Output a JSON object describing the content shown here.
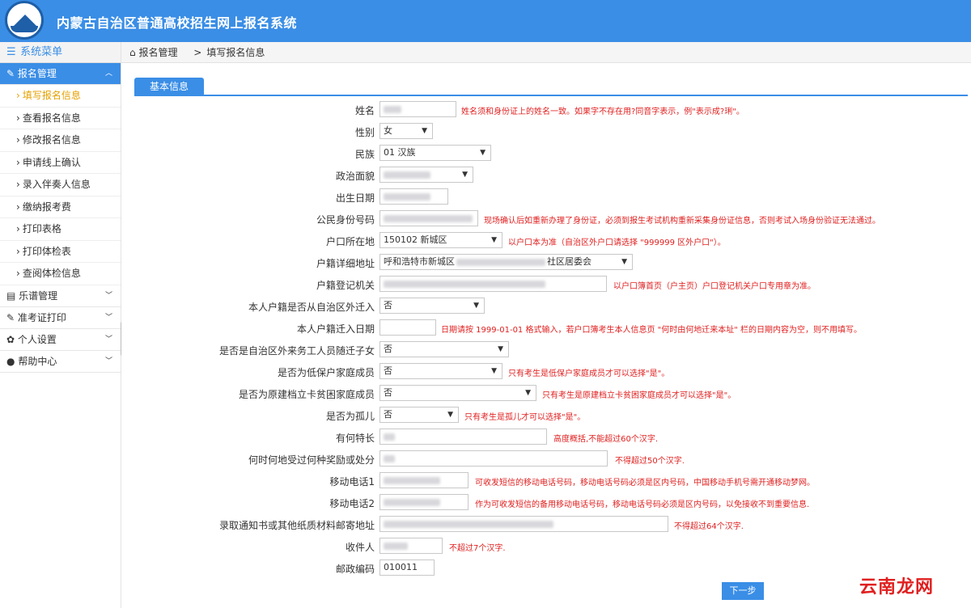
{
  "app": {
    "title": "内蒙古自治区普通高校招生网上报名系统"
  },
  "sidebar": {
    "header": "系统菜单",
    "groups": [
      {
        "label": "报名管理",
        "active": true,
        "items": [
          {
            "label": "填写报名信息",
            "current": true
          },
          {
            "label": "查看报名信息"
          },
          {
            "label": "修改报名信息"
          },
          {
            "label": "申请线上确认"
          },
          {
            "label": "录入伴奏人信息"
          },
          {
            "label": "缴纳报考费"
          },
          {
            "label": "打印表格"
          },
          {
            "label": "打印体检表"
          },
          {
            "label": "查阅体检信息"
          }
        ]
      },
      {
        "label": "乐谱管理"
      },
      {
        "label": "准考证打印"
      },
      {
        "label": "个人设置"
      },
      {
        "label": "帮助中心"
      }
    ]
  },
  "breadcrumb": {
    "home": "报名管理",
    "current": "填写报名信息"
  },
  "tab": "基本信息",
  "form": {
    "fields": [
      {
        "label": "姓名",
        "value": "",
        "hint": "姓名须和身份证上的姓名一致。如果字不存在用?同音字表示，例\"表示成?琍\"。"
      },
      {
        "label": "性别",
        "value": "女"
      },
      {
        "label": "民族",
        "value": "01 汉族"
      },
      {
        "label": "政治面貌",
        "value": ""
      },
      {
        "label": "出生日期",
        "value": ""
      },
      {
        "label": "公民身份号码",
        "value": "",
        "hint": "现场确认后如重新办理了身份证，必须到报生考试机构重新采集身份证信息，否则考试入场身份验证无法通过。"
      },
      {
        "label": "户口所在地",
        "value": "150102 新城区",
        "hint": "以户口本为准（自治区外户口请选择 \"999999 区外户口\"）。"
      },
      {
        "label": "户籍详细地址",
        "value": "呼和浩特市新城区",
        "value_tail": "社区居委会"
      },
      {
        "label": "户籍登记机关",
        "value": "",
        "hint": "以户口簿首页（户主页）户口登记机关户口专用章为准。"
      },
      {
        "label": "本人户籍是否从自治区外迁入",
        "value": "否"
      },
      {
        "label": "本人户籍迁入日期",
        "value": "",
        "hint": "日期请按 1999-01-01 格式输入，若户口簿考生本人信息页 \"何时由何地迁来本址\" 栏的日期内容为空，则不用填写。"
      },
      {
        "label": "是否是自治区外来务工人员随迁子女",
        "value": "否"
      },
      {
        "label": "是否为低保户家庭成员",
        "value": "否",
        "hint": "只有考生是低保户家庭成员才可以选择\"是\"。"
      },
      {
        "label": "是否为原建档立卡贫困家庭成员",
        "value": "否",
        "hint": "只有考生是原建档立卡贫困家庭成员才可以选择\"是\"。"
      },
      {
        "label": "是否为孤儿",
        "value": "否",
        "hint": "只有考生是孤儿才可以选择\"是\"。"
      },
      {
        "label": "有何特长",
        "value": "",
        "hint": "高度概括,不能超过60个汉字."
      },
      {
        "label": "何时何地受过何种奖励或处分",
        "value": "",
        "hint": "不得超过50个汉字."
      },
      {
        "label": "移动电话1",
        "value": "",
        "hint": "可收发短信的移动电话号码，移动电话号码必须是区内号码，中国移动手机号需开通移动梦网。"
      },
      {
        "label": "移动电话2",
        "value": "",
        "hint": "作为可收发短信的备用移动电话号码，移动电话号码必须是区内号码，以免接收不到重要信息."
      },
      {
        "label": "录取通知书或其他纸质材料邮寄地址",
        "value": "",
        "hint": "不得超过64个汉字."
      },
      {
        "label": "收件人",
        "value": "",
        "hint": "不超过7个汉字."
      },
      {
        "label": "邮政编码",
        "value": "010011"
      }
    ],
    "next_button": "下一步"
  },
  "watermark": "云南龙网",
  "colors": {
    "primary": "#3a8ee6",
    "hint": "#e02020",
    "current": "#e5a000"
  }
}
